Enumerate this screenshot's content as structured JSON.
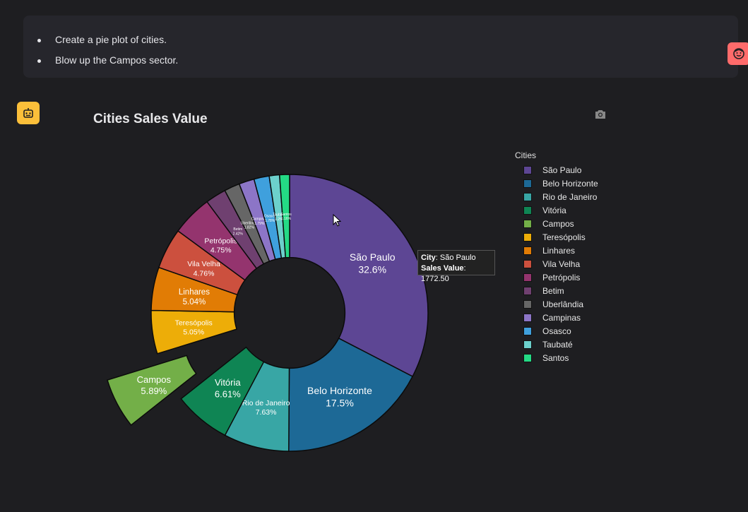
{
  "user_message": {
    "items": [
      "Create a pie plot of cities.",
      "Blow up the Campos sector."
    ]
  },
  "colors": {
    "user_avatar": "#ff6b6b",
    "bot_avatar": "#fbbf3a",
    "background": "#1e1e21"
  },
  "icons": {
    "user": "face-icon",
    "bot": "robot-icon",
    "toolbar": "camera-icon"
  },
  "tooltip": {
    "city_label": "City",
    "city_value": "São Paulo",
    "sales_label": "Sales Value",
    "sales_value": "1772.50"
  },
  "chart_data": {
    "type": "pie",
    "title": "Cities Sales Value",
    "hole": 0.4,
    "legend_title": "Cities",
    "legend_position": "right",
    "pulled": "Campos",
    "series": [
      {
        "name": "São Paulo",
        "value": 32.6,
        "label": "32.6%",
        "color": "#5d4694"
      },
      {
        "name": "Belo Horizonte",
        "value": 17.5,
        "label": "17.5%",
        "color": "#1d6996"
      },
      {
        "name": "Rio de Janeiro",
        "value": 7.63,
        "label": "7.63%",
        "color": "#38a6a5"
      },
      {
        "name": "Vitória",
        "value": 6.61,
        "label": "6.61%",
        "color": "#0f8554"
      },
      {
        "name": "Campos",
        "value": 5.89,
        "label": "5.89%",
        "color": "#73af48"
      },
      {
        "name": "Teresópolis",
        "value": 5.05,
        "label": "5.05%",
        "color": "#edad08"
      },
      {
        "name": "Linhares",
        "value": 5.04,
        "label": "5.04%",
        "color": "#e17c05"
      },
      {
        "name": "Vila Velha",
        "value": 4.76,
        "label": "4.76%",
        "color": "#cc503e"
      },
      {
        "name": "Petrópolis",
        "value": 4.75,
        "label": "4.75%",
        "color": "#94346e"
      },
      {
        "name": "Betim",
        "value": 2.42,
        "label": "2.42%",
        "color": "#6f4070"
      },
      {
        "name": "Uberlândia",
        "value": 1.82,
        "label": "1.82%",
        "color": "#666666"
      },
      {
        "name": "Campinas",
        "value": 1.79,
        "label": "1.79%",
        "color": "#8c75c7"
      },
      {
        "name": "Osasco",
        "value": 1.78,
        "label": "1.78%",
        "color": "#3fa0dd"
      },
      {
        "name": "Taubaté",
        "value": 1.2,
        "label": "1.2%",
        "color": "#6cd0cc"
      },
      {
        "name": "Santos",
        "value": 1.16,
        "label": "1.16%",
        "color": "#24da85"
      }
    ]
  }
}
